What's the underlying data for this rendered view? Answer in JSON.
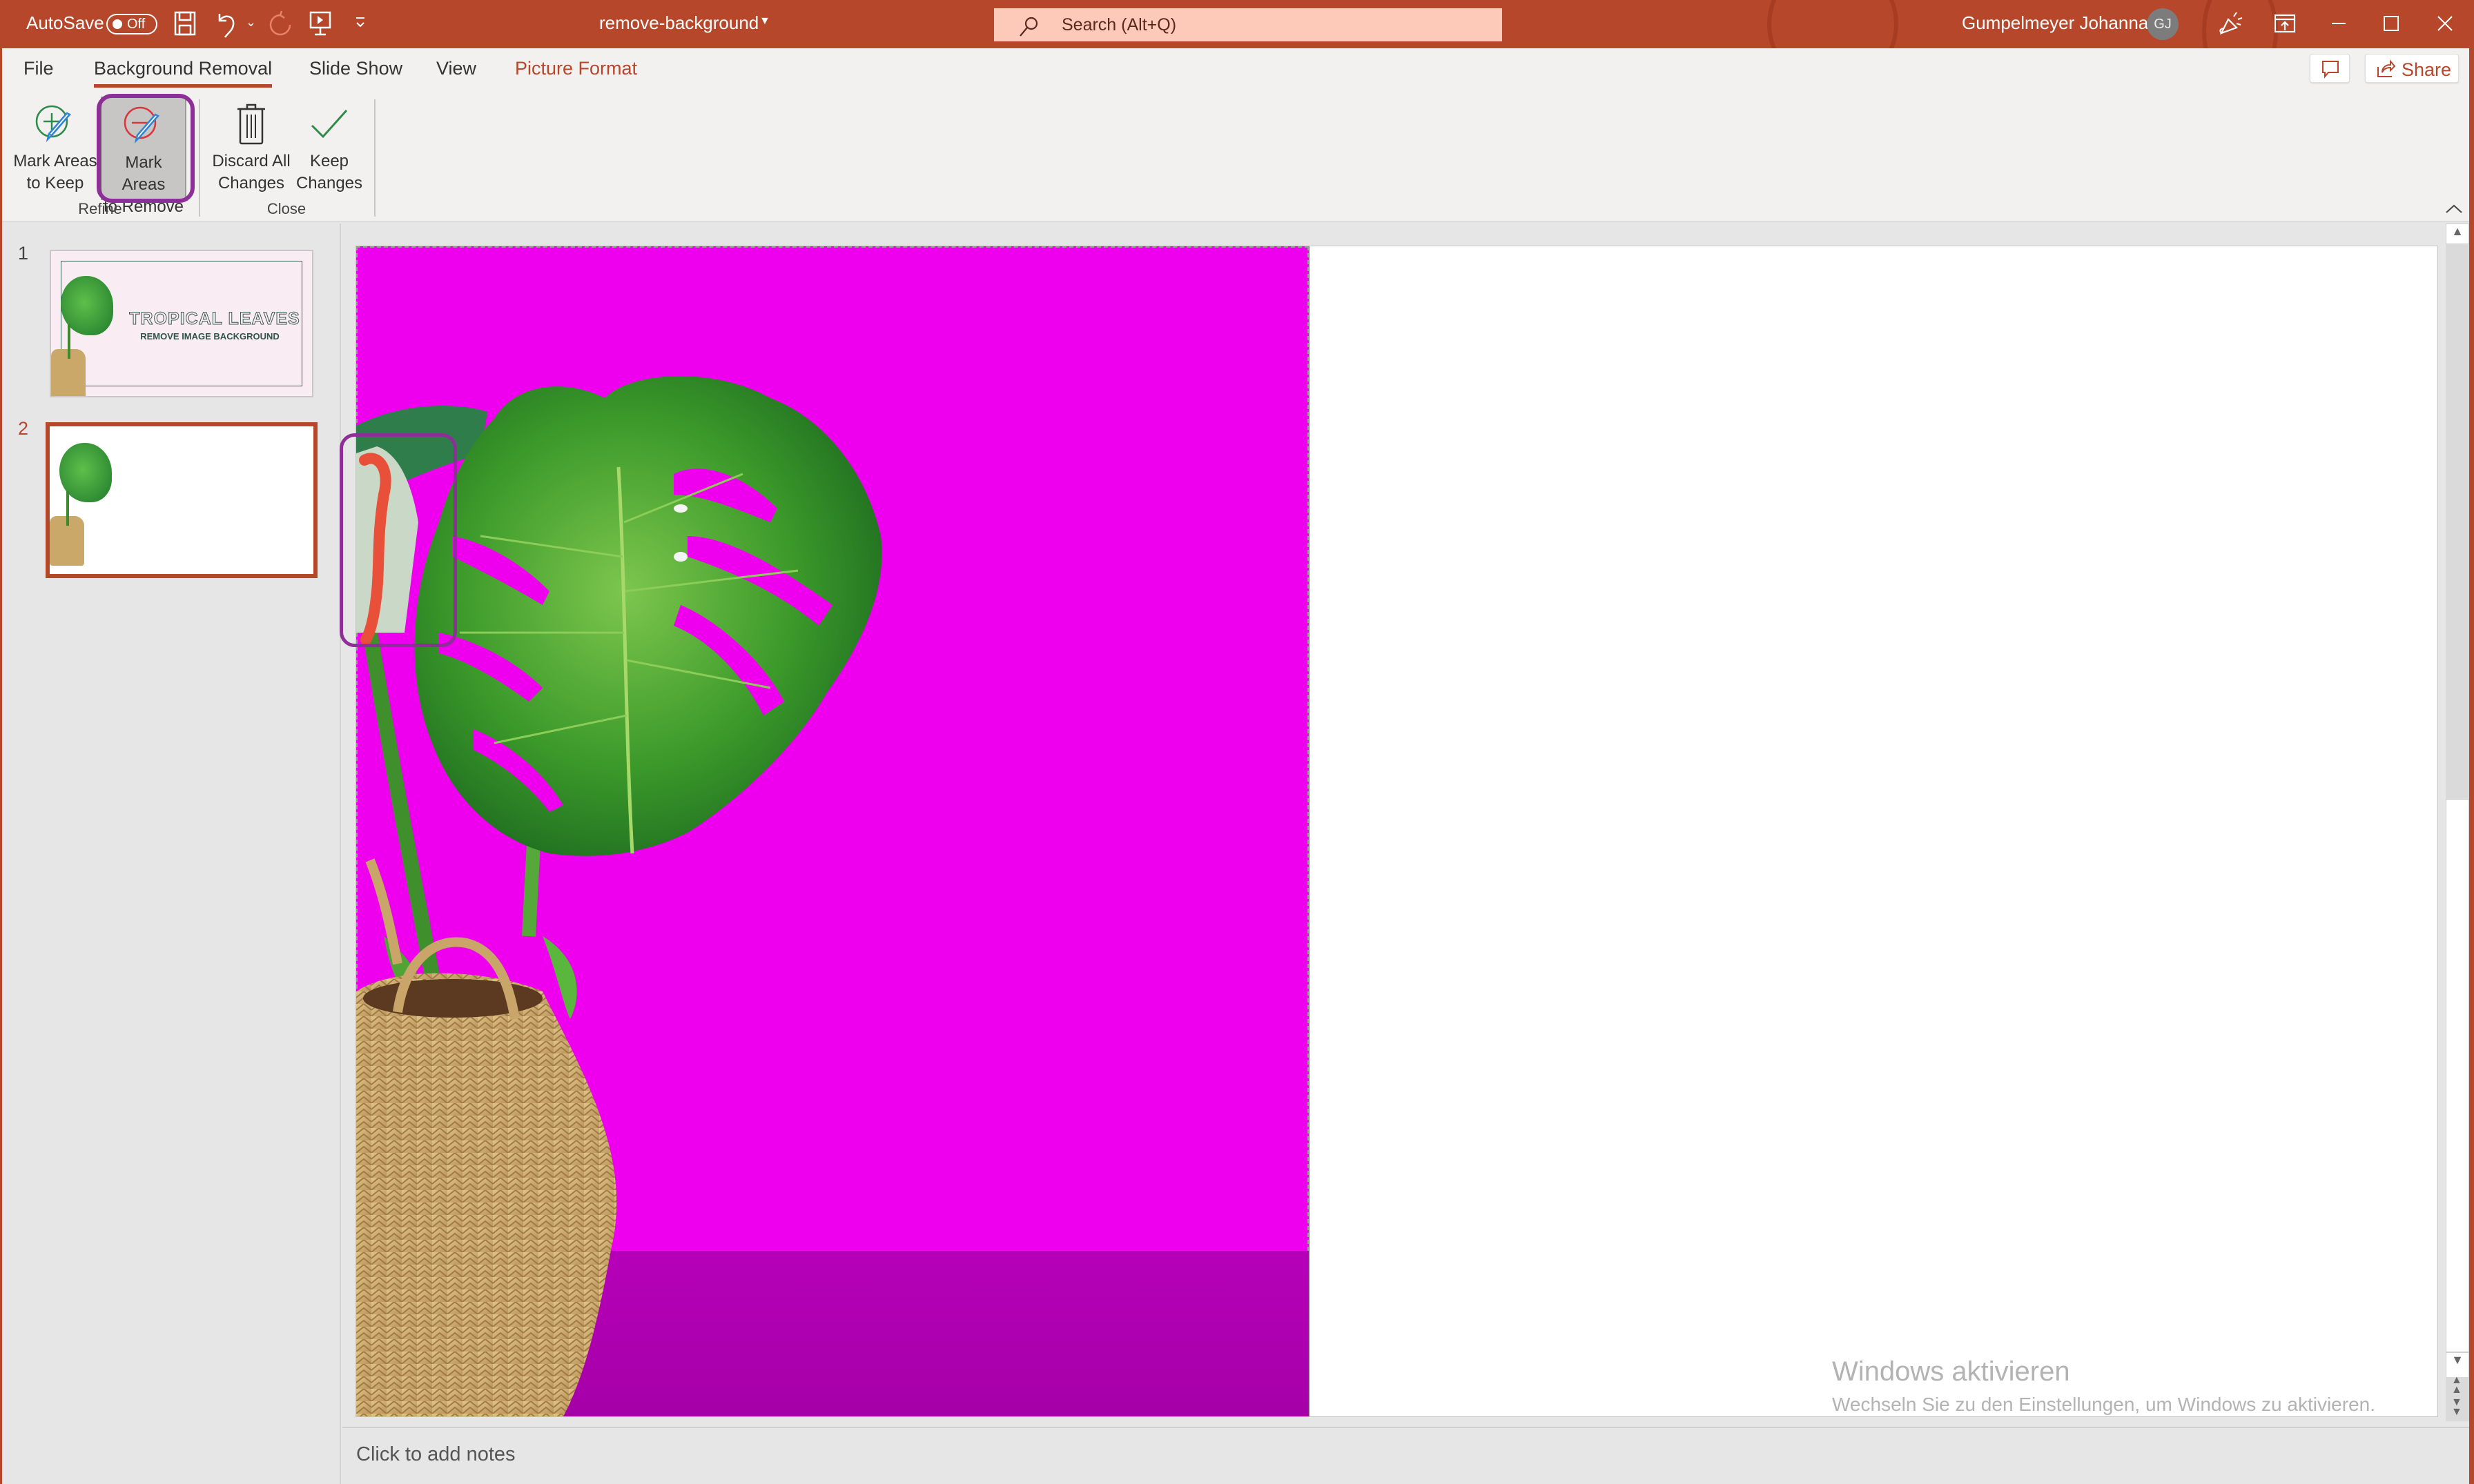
{
  "titlebar": {
    "autosave_label": "AutoSave",
    "autosave_state": "Off",
    "document_title": "remove-background",
    "search_placeholder": "Search (Alt+Q)",
    "user_name": "Gumpelmeyer Johanna",
    "user_initials": "GJ",
    "icons": [
      "save-icon",
      "undo-icon",
      "redo-icon",
      "present-from-start-icon",
      "customize-quick-access-icon",
      "coauthoring-icon",
      "ribbon-display-options-icon",
      "minimize-icon",
      "maximize-icon",
      "close-icon"
    ]
  },
  "tabs": [
    {
      "label": "File",
      "active": false
    },
    {
      "label": "Background Removal",
      "active": true
    },
    {
      "label": "Slide Show",
      "active": false
    },
    {
      "label": "View",
      "active": false
    },
    {
      "label": "Picture Format",
      "active": false,
      "contextual": true
    }
  ],
  "header_buttons": {
    "comments_icon": "comment-icon",
    "share_label": "Share"
  },
  "ribbon": {
    "groups": [
      {
        "label": "Refine",
        "buttons": [
          {
            "label": "Mark Areas\nto Keep",
            "icon": "mark-keep-icon",
            "pressed": false
          },
          {
            "label": "Mark Areas\nto Remove",
            "icon": "mark-remove-icon",
            "pressed": true
          }
        ]
      },
      {
        "label": "Close",
        "buttons": [
          {
            "label": "Discard All\nChanges",
            "icon": "trash-icon",
            "pressed": false
          },
          {
            "label": "Keep\nChanges",
            "icon": "checkmark-icon",
            "pressed": false
          }
        ]
      }
    ]
  },
  "slides": [
    {
      "number": "1",
      "title": "TROPICAL LEAVES",
      "subtitle": "REMOVE IMAGE BACKGROUND",
      "selected": false
    },
    {
      "number": "2",
      "selected": true
    }
  ],
  "notes_placeholder": "Click to add notes",
  "watermark": {
    "title": "Windows aktivieren",
    "subtitle": "Wechseln Sie zu den Einstellungen, um Windows zu aktivieren."
  },
  "colors": {
    "accent": "#b7472a",
    "removal_overlay": "#ee00ee",
    "highlight_ring": "#8e2f98",
    "remove_stroke": "#e8503a"
  }
}
